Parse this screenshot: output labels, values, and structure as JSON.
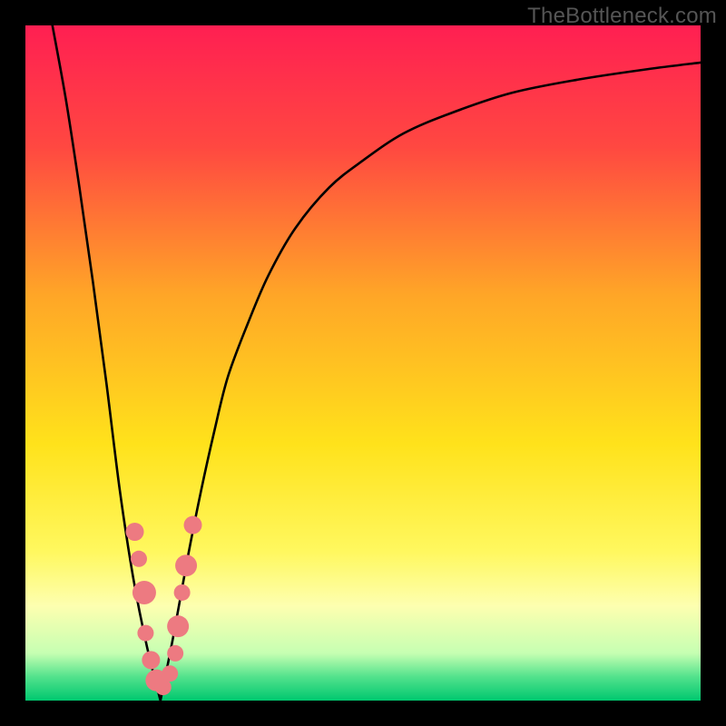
{
  "watermark": "TheBottleneck.com",
  "chart_data": {
    "type": "line",
    "title": "",
    "xlabel": "",
    "ylabel": "",
    "xlim": [
      0,
      100
    ],
    "ylim": [
      0,
      100
    ],
    "background_gradient_stops": [
      {
        "pos": 0.0,
        "color": "#ff1f52"
      },
      {
        "pos": 0.18,
        "color": "#ff4841"
      },
      {
        "pos": 0.4,
        "color": "#ffa627"
      },
      {
        "pos": 0.62,
        "color": "#ffe21b"
      },
      {
        "pos": 0.78,
        "color": "#fff85f"
      },
      {
        "pos": 0.86,
        "color": "#fdffb0"
      },
      {
        "pos": 0.93,
        "color": "#c6ffb2"
      },
      {
        "pos": 0.965,
        "color": "#52e28c"
      },
      {
        "pos": 1.0,
        "color": "#00c86f"
      }
    ],
    "series": [
      {
        "name": "left-branch",
        "x": [
          4,
          6,
          8,
          10,
          12,
          14,
          16,
          18,
          20
        ],
        "y": [
          100,
          89,
          76,
          62,
          47,
          31,
          18,
          8,
          0
        ]
      },
      {
        "name": "right-branch",
        "x": [
          20,
          22,
          24,
          26,
          28,
          30,
          33,
          36,
          40,
          45,
          50,
          56,
          63,
          72,
          82,
          92,
          100
        ],
        "y": [
          0,
          10,
          21,
          31,
          40,
          48,
          56,
          63,
          70,
          76,
          80,
          84,
          87,
          90,
          92,
          93.5,
          94.5
        ]
      }
    ],
    "markers": {
      "name": "scatter-points",
      "color": "#ed7a81",
      "points": [
        {
          "x": 16.2,
          "y": 25,
          "r": 10
        },
        {
          "x": 16.8,
          "y": 21,
          "r": 9
        },
        {
          "x": 17.6,
          "y": 16,
          "r": 13
        },
        {
          "x": 17.8,
          "y": 10,
          "r": 9
        },
        {
          "x": 18.6,
          "y": 6,
          "r": 10
        },
        {
          "x": 19.4,
          "y": 3,
          "r": 12
        },
        {
          "x": 20.4,
          "y": 2,
          "r": 9
        },
        {
          "x": 21.4,
          "y": 4,
          "r": 9
        },
        {
          "x": 22.2,
          "y": 7,
          "r": 9
        },
        {
          "x": 22.6,
          "y": 11,
          "r": 12
        },
        {
          "x": 23.2,
          "y": 16,
          "r": 9
        },
        {
          "x": 23.8,
          "y": 20,
          "r": 12
        },
        {
          "x": 24.8,
          "y": 26,
          "r": 10
        }
      ]
    }
  }
}
